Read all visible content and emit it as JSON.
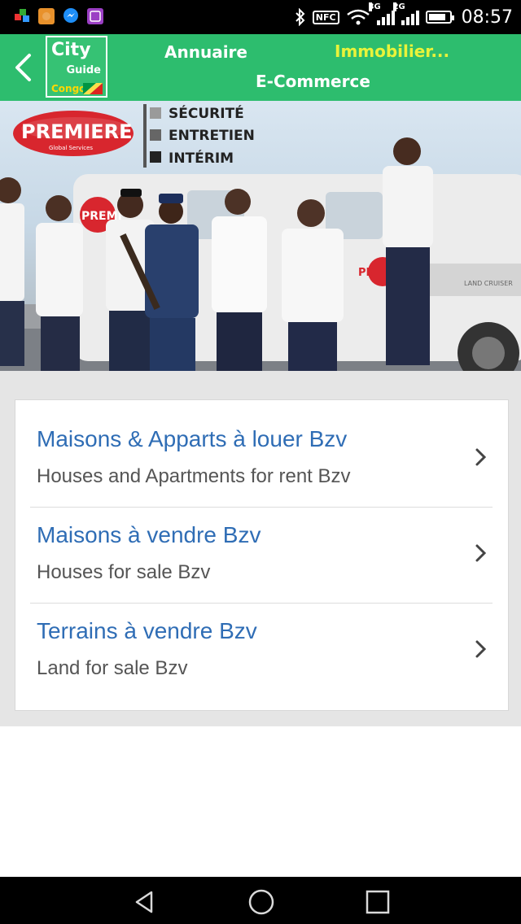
{
  "status_bar": {
    "time": "08:57",
    "nfc_label": "NFC",
    "net1": "3G",
    "net2": "2G",
    "battery_level_pct": 85,
    "app_icons": [
      "puzzle-app-icon",
      "orange-app-icon",
      "messenger-icon",
      "purple-app-icon"
    ]
  },
  "app_bar": {
    "logo": {
      "line1": "City",
      "line2": "Guide",
      "line3": "Congo"
    },
    "nav": {
      "annuaire": "Annuaire",
      "immobilier": "Immobilier...",
      "ecommerce": "E-Commerce"
    },
    "colors": {
      "background": "#2dbd6e",
      "active_nav": "#e9f33a"
    }
  },
  "banner": {
    "brand": "PREMIERE",
    "brand_sub": "Global Services",
    "services": [
      "SÉCURITÉ",
      "ENTRETIEN",
      "INTÉRIM"
    ],
    "van_text": "PREMIERE",
    "van_model": "LAND CRUISER"
  },
  "list": {
    "items": [
      {
        "title": "Maisons & Apparts à louer Bzv",
        "subtitle": "Houses and Apartments for rent Bzv"
      },
      {
        "title": "Maisons à vendre Bzv",
        "subtitle": "Houses for sale Bzv"
      },
      {
        "title": "Terrains à vendre Bzv",
        "subtitle": "Land for sale Bzv"
      }
    ],
    "title_color": "#2f6db5"
  },
  "nav_bar": {
    "buttons": [
      "back-icon",
      "home-icon",
      "recents-icon"
    ]
  }
}
